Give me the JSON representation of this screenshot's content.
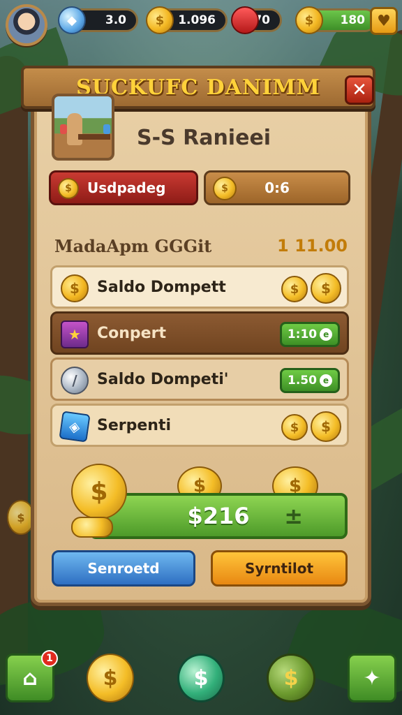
{
  "hud": {
    "level": "3.0",
    "coins": "1.096",
    "rubies": "070",
    "gems": "180",
    "heart_icon": "heart-icon"
  },
  "dialog": {
    "title": "SUCKUFC DANIMM",
    "subtitle": "S-S Ranieei",
    "red_button_label": "Usdpadeg",
    "brown_button_label": "0:6",
    "list_label": "MadaApm GGGit",
    "list_value": "1 11.00",
    "rows": [
      {
        "label": "Saldo Dompett",
        "icon": "gold-coin-icon"
      },
      {
        "label": "Conpert",
        "icon": "chest-icon",
        "badge": "1:10"
      },
      {
        "label": "Saldo Dompeti'",
        "icon": "silver-coin-icon",
        "badge": "1.50"
      },
      {
        "label": "Serpenti",
        "icon": "blue-cube-icon"
      }
    ],
    "total": "$216",
    "total_suffix": "±",
    "blue_button_label": "Senroetd",
    "orange_button_label": "Syrntilot"
  },
  "bottom_nav": {
    "home_badge": "1",
    "items": [
      "home-icon",
      "gold-coin-icon",
      "dollar-coin-icon",
      "dollar-coin-icon",
      "trophy-icon"
    ]
  },
  "colors": {
    "panel": "#e8cfa5",
    "title_gold": "#ffd23a",
    "green": "#4d9a29",
    "red": "#c93a32",
    "blue": "#2e6fc2",
    "orange": "#e88812"
  }
}
